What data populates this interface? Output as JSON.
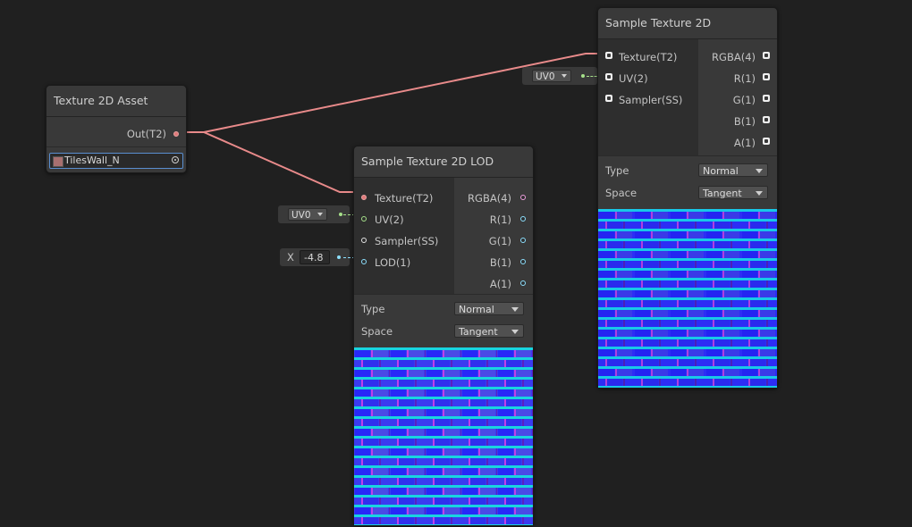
{
  "colors": {
    "texture_wire": "#e88a8a",
    "vector_wire": "#8de0ff",
    "uv_wire": "#a6e08a",
    "background": "#202020",
    "node": "#393939"
  },
  "asset_node": {
    "title": "Texture 2D Asset",
    "output": "Out(T2)",
    "asset_name": "TilesWall_N",
    "asset_picker_icon": "target-icon"
  },
  "lod_node": {
    "title": "Sample Texture 2D LOD",
    "inputs": [
      "Texture(T2)",
      "UV(2)",
      "Sampler(SS)",
      "LOD(1)"
    ],
    "outputs": [
      "RGBA(4)",
      "R(1)",
      "G(1)",
      "B(1)",
      "A(1)"
    ],
    "type_label": "Type",
    "type_value": "Normal",
    "space_label": "Space",
    "space_value": "Tangent",
    "uv_value": "UV0",
    "lod_axis": "X",
    "lod_value": "-4.8"
  },
  "sample_node": {
    "title": "Sample Texture 2D",
    "inputs": [
      "Texture(T2)",
      "UV(2)",
      "Sampler(SS)"
    ],
    "outputs": [
      "RGBA(4)",
      "R(1)",
      "G(1)",
      "B(1)",
      "A(1)"
    ],
    "type_label": "Type",
    "type_value": "Normal",
    "space_label": "Space",
    "space_value": "Tangent",
    "uv_value": "UV0"
  }
}
